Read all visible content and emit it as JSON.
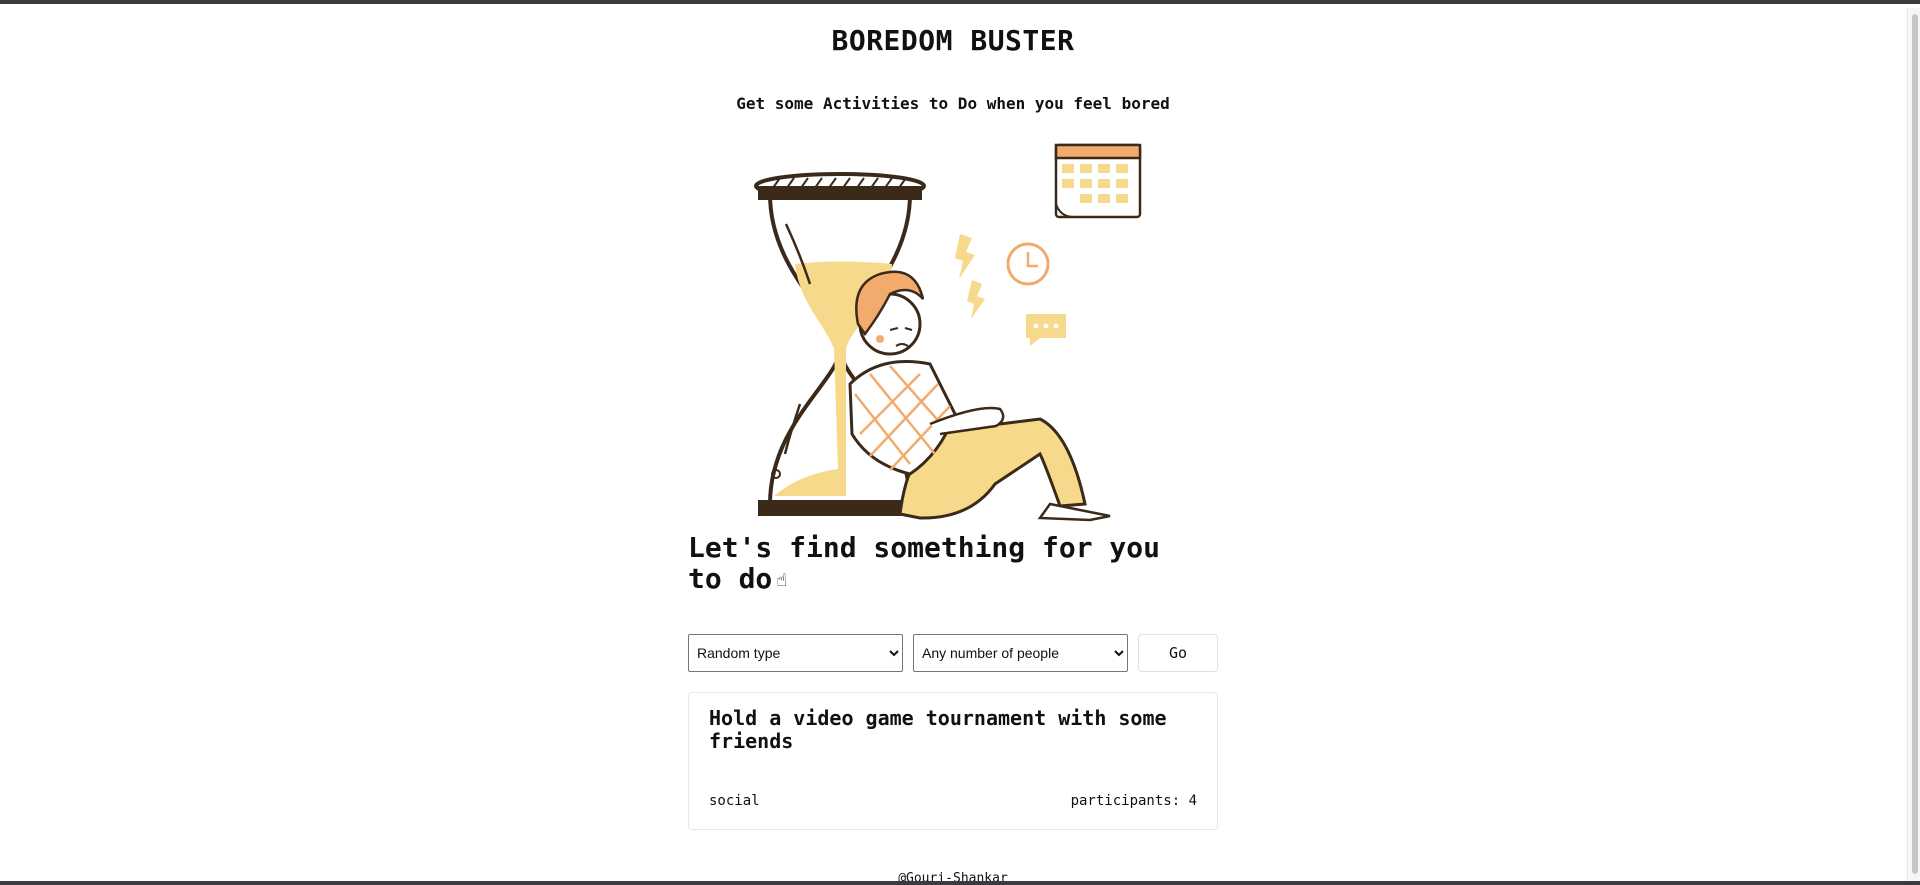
{
  "app": {
    "title": "BOREDOM BUSTER",
    "subtitle": "Get some Activities to Do when you feel bored"
  },
  "illustration": {
    "icon": "bored-person-hourglass-illustration",
    "colors": {
      "outline": "#3b2a1a",
      "sand": "#f7d98b",
      "hair": "#f2ab6d",
      "accent": "#f0c070"
    }
  },
  "heading": {
    "text": "Let's find something for you to do",
    "icon": "pointing-hand-icon"
  },
  "filters": {
    "type_selected": "Random type",
    "people_selected": "Any number of people",
    "go_label": "Go"
  },
  "activity": {
    "title": "Hold a video game tournament with some friends",
    "type": "social",
    "participants": "participants: 4"
  },
  "footer": {
    "credit": "@Gouri-Shankar"
  }
}
